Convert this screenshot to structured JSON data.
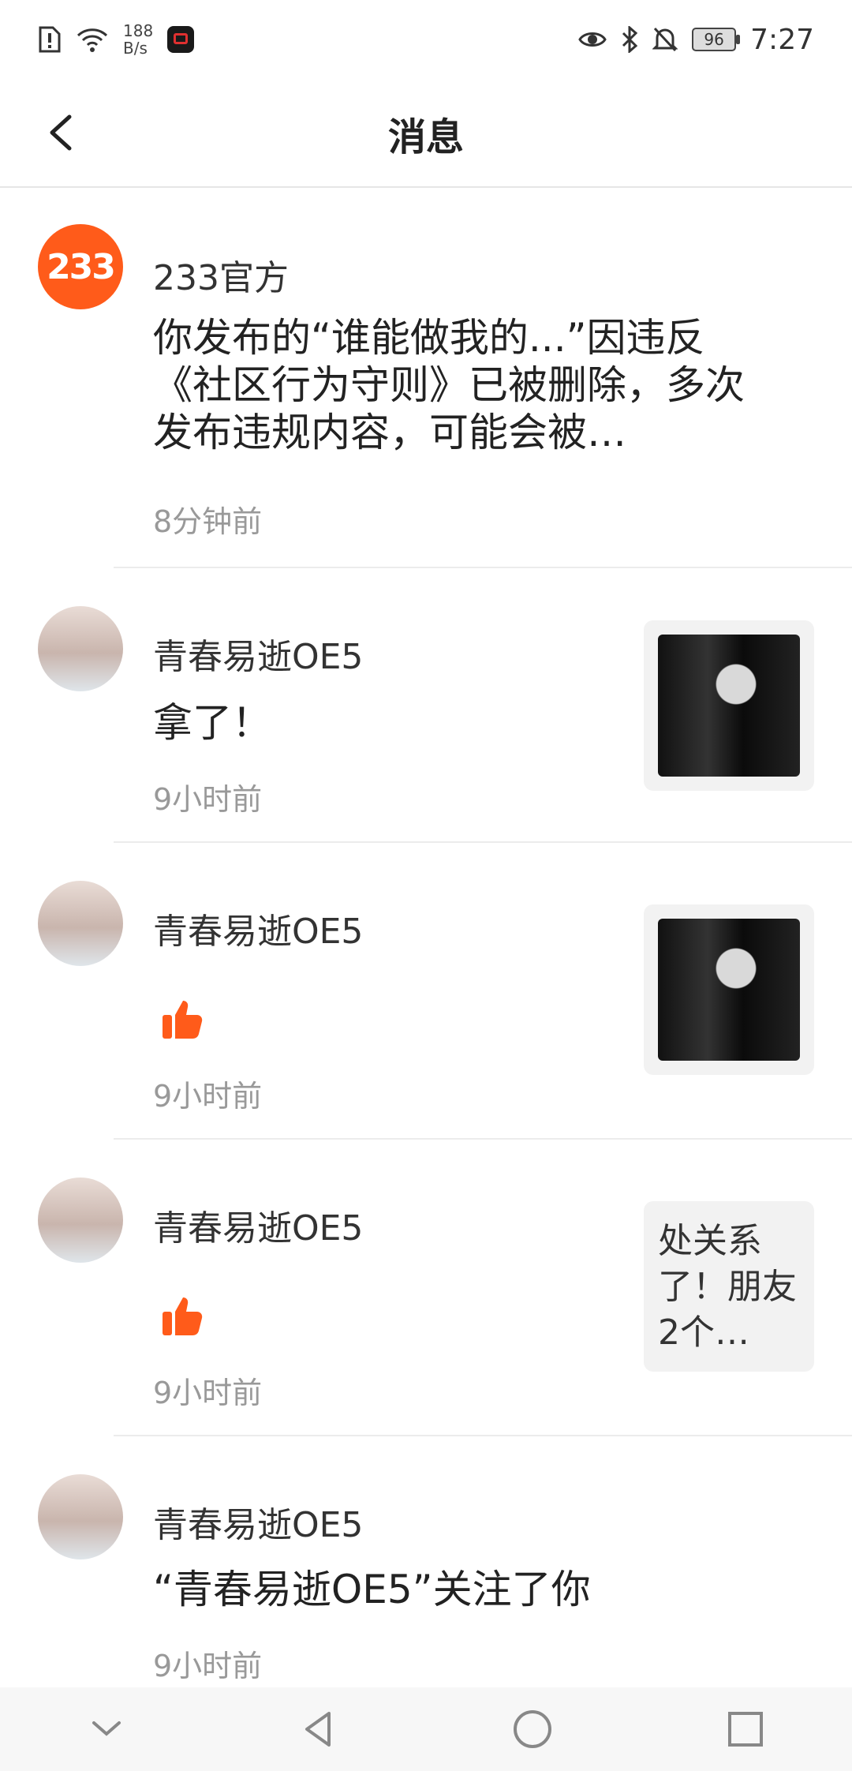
{
  "status": {
    "net_speed_value": "188",
    "net_speed_unit": "B/s",
    "battery": "96",
    "time": "7:27"
  },
  "header": {
    "title": "消息"
  },
  "messages": [
    {
      "name": "233官方",
      "avatar_text": "233",
      "content": "你发布的“谁能做我的...”因违反《社区行为守则》已被删除，多次发布违规内容，可能会被…",
      "time": "8分钟前"
    },
    {
      "name": "青春易逝OE5",
      "content": "拿了！",
      "time": "9小时前"
    },
    {
      "name": "青春易逝OE5",
      "icon": "thumbs-up-icon",
      "time": "9小时前"
    },
    {
      "name": "青春易逝OE5",
      "icon": "thumbs-up-icon",
      "time": "9小时前",
      "preview_text": "处关系了！朋友2个…"
    },
    {
      "name": "青春易逝OE5",
      "content": "“青春易逝OE5”关注了你",
      "time": "9小时前"
    }
  ],
  "colors": {
    "accent": "#ff5b1a"
  }
}
